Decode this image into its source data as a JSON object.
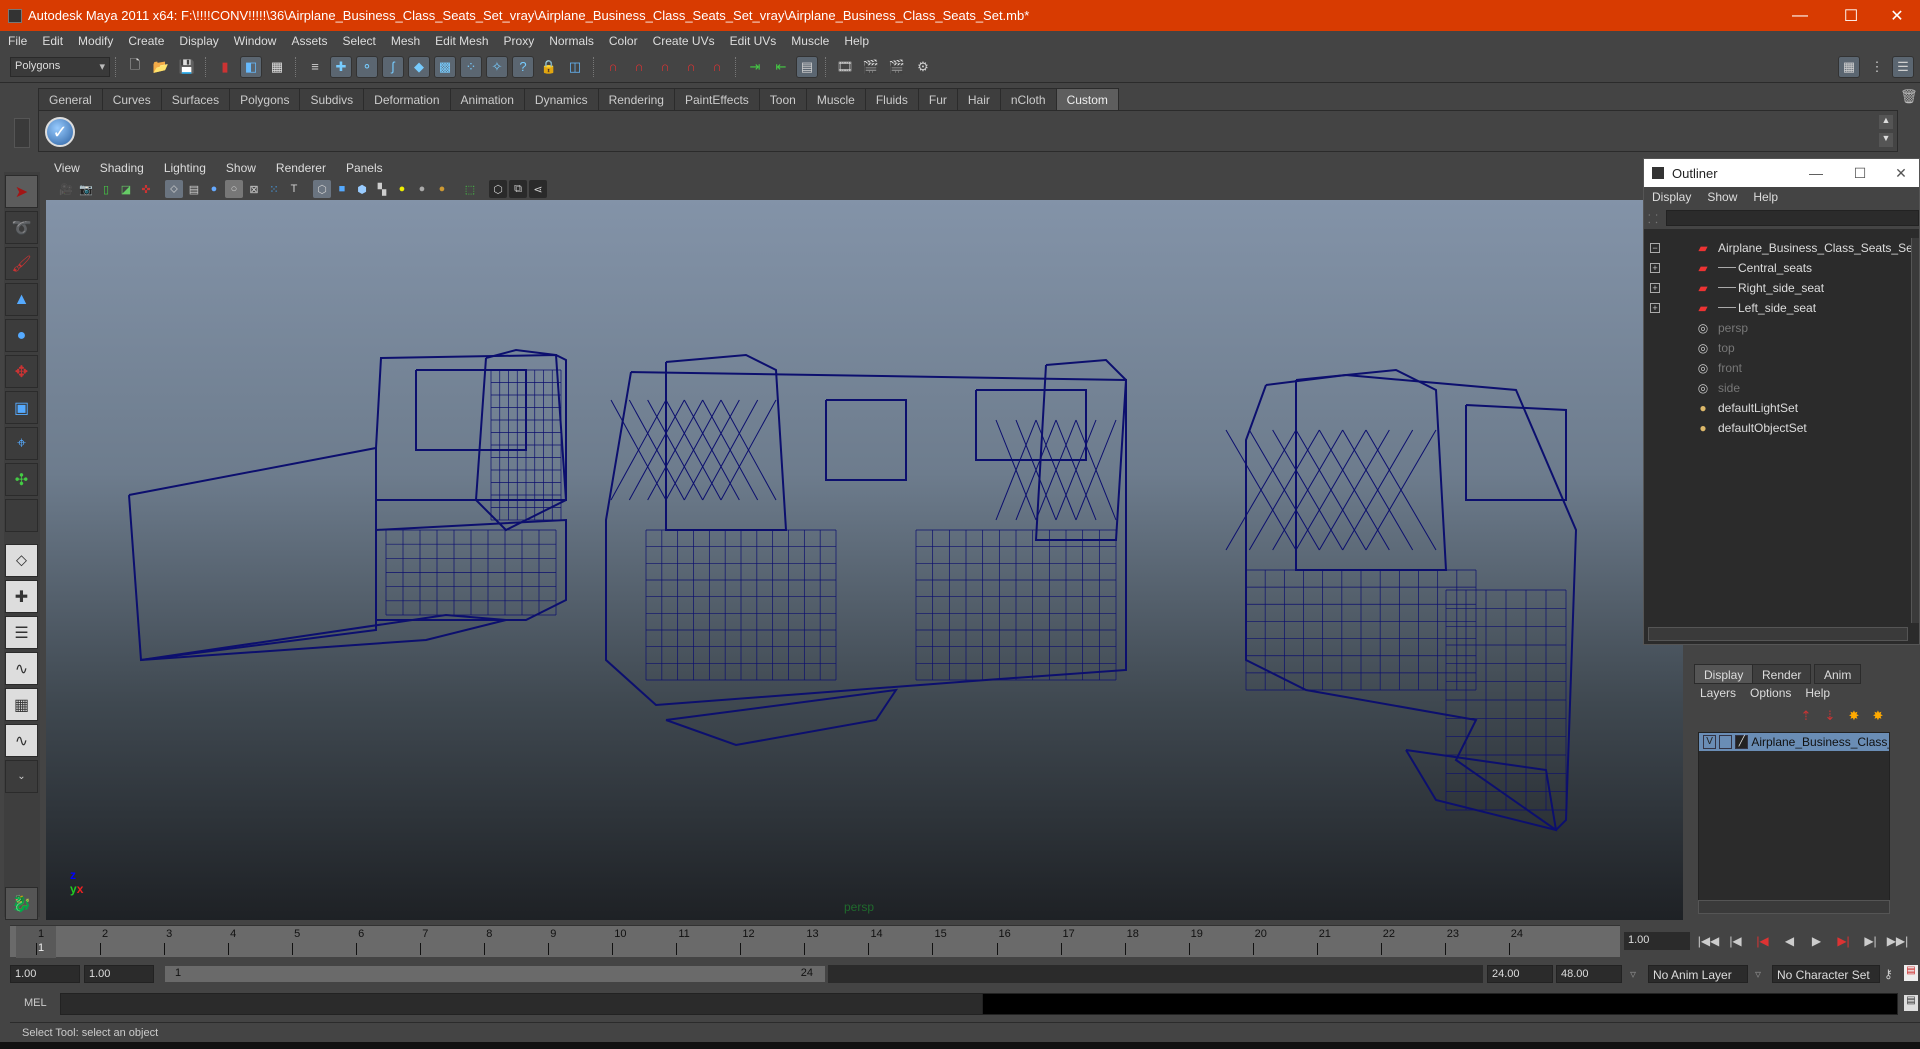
{
  "window": {
    "title": "Autodesk Maya 2011 x64: F:\\!!!!CONV!!!!!\\36\\Airplane_Business_Class_Seats_Set_vray\\Airplane_Business_Class_Seats_Set_vray\\Airplane_Business_Class_Seats_Set.mb*",
    "minimize": "—",
    "maximize": "☐",
    "close": "✕"
  },
  "menubar": [
    "File",
    "Edit",
    "Modify",
    "Create",
    "Display",
    "Window",
    "Assets",
    "Select",
    "Mesh",
    "Edit Mesh",
    "Proxy",
    "Normals",
    "Color",
    "Create UVs",
    "Edit UVs",
    "Muscle",
    "Help"
  ],
  "statusline": {
    "mode": "Polygons"
  },
  "shelf": {
    "tabs": [
      "General",
      "Curves",
      "Surfaces",
      "Polygons",
      "Subdivs",
      "Deformation",
      "Animation",
      "Dynamics",
      "Rendering",
      "PaintEffects",
      "Toon",
      "Muscle",
      "Fluids",
      "Fur",
      "Hair",
      "nCloth",
      "Custom"
    ],
    "active_tab": "Custom"
  },
  "viewport": {
    "menus": [
      "View",
      "Shading",
      "Lighting",
      "Show",
      "Renderer",
      "Panels"
    ],
    "camera_label": "persp",
    "axis": {
      "x": "x",
      "y": "y",
      "z": "z"
    },
    "wire_color": "#0c0f6e"
  },
  "outliner": {
    "title": "Outliner",
    "menus": [
      "Display",
      "Show",
      "Help"
    ],
    "items": [
      {
        "label": "Airplane_Business_Class_Seats_Set",
        "icon": "transform-icon",
        "expander": "−",
        "dim": false
      },
      {
        "label": "Central_seats",
        "icon": "transform-icon",
        "expander": "+",
        "dim": false
      },
      {
        "label": "Right_side_seat",
        "icon": "transform-icon",
        "expander": "+",
        "dim": false
      },
      {
        "label": "Left_side_seat",
        "icon": "transform-icon",
        "expander": "+",
        "dim": false
      },
      {
        "label": "persp",
        "icon": "camera-icon",
        "expander": "",
        "dim": true
      },
      {
        "label": "top",
        "icon": "camera-icon",
        "expander": "",
        "dim": true
      },
      {
        "label": "front",
        "icon": "camera-icon",
        "expander": "",
        "dim": true
      },
      {
        "label": "side",
        "icon": "camera-icon",
        "expander": "",
        "dim": true
      },
      {
        "label": "defaultLightSet",
        "icon": "set-icon",
        "expander": "",
        "dim": false
      },
      {
        "label": "defaultObjectSet",
        "icon": "set-icon",
        "expander": "",
        "dim": false
      }
    ]
  },
  "layers": {
    "tabs": [
      "Display",
      "Render",
      "Anim"
    ],
    "active_tab": "Display",
    "menus": [
      "Layers",
      "Options",
      "Help"
    ],
    "rows": [
      {
        "visible": "V",
        "name": "Airplane_Business_Class_Seats_Set"
      }
    ]
  },
  "timeline": {
    "ticks": [
      "1",
      "2",
      "3",
      "4",
      "5",
      "6",
      "7",
      "8",
      "9",
      "10",
      "11",
      "12",
      "13",
      "14",
      "15",
      "16",
      "17",
      "18",
      "19",
      "20",
      "21",
      "22",
      "23",
      "24"
    ],
    "current_frame_marker": "1",
    "current_time": "1.00"
  },
  "range": {
    "start_time": "1.00",
    "playback_start": "1.00",
    "range_start_label": "1",
    "range_end_label": "24",
    "playback_end": "24.00",
    "end_time": "48.00",
    "anim_layer": "No Anim Layer",
    "character_set": "No Character Set"
  },
  "command_line": {
    "label": "MEL",
    "value": "",
    "result": ""
  },
  "help_line": "Select Tool: select an object"
}
